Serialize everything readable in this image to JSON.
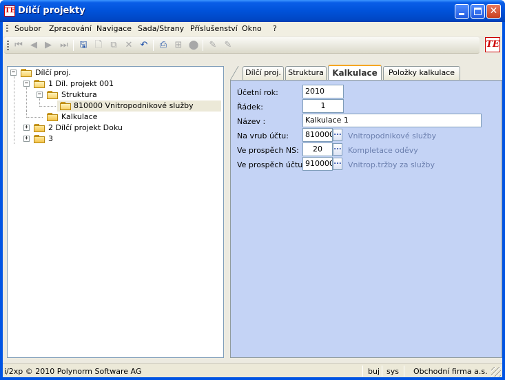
{
  "window": {
    "title": "Dílčí projekty",
    "app_icon": "TE"
  },
  "menu": [
    {
      "label": "Soubor"
    },
    {
      "label": "Zpracování"
    },
    {
      "label": "Navigace"
    },
    {
      "label": "Sada/Strany"
    },
    {
      "label": "Příslušenství"
    },
    {
      "label": "Okno"
    },
    {
      "label": "?"
    }
  ],
  "toolbar": {
    "logo": "TE"
  },
  "tree": {
    "root": "Dílčí proj.",
    "items": [
      {
        "label": "1 Díl. projekt 001"
      },
      {
        "label": "Struktura"
      },
      {
        "label": "810000 Vnitropodnikové služby"
      },
      {
        "label": "Kalkulace"
      },
      {
        "label": "2 Dílčí projekt Doku"
      },
      {
        "label": "3"
      }
    ]
  },
  "tabs": [
    {
      "label": "Dílčí proj."
    },
    {
      "label": "Struktura"
    },
    {
      "label": "Kalkulace"
    },
    {
      "label": "Položky kalkulace"
    }
  ],
  "form": {
    "ucetni_rok": {
      "label": "Účetní rok:",
      "value": "2010"
    },
    "radek": {
      "label": "Řádek:",
      "value": "1"
    },
    "nazev": {
      "label": "Název     :",
      "value": "Kalkulace 1"
    },
    "na_vrub": {
      "label": "Na vrub účtu:",
      "value": "810000",
      "desc": "Vnitropodnikové služby"
    },
    "ve_prospech_ns": {
      "label": "Ve prospěch NS:",
      "value": "20",
      "desc": "Kompletace oděvy"
    },
    "ve_prospech_uctu": {
      "label": "Ve prospěch účtu:",
      "value": "910000",
      "desc": "Vnitrop.tržby za služby"
    },
    "browse": "..."
  },
  "status": {
    "copyright": "i/2xp © 2010 Polynorm Software AG",
    "user": "buj",
    "system": "sys",
    "company": "Obchodní firma a.s."
  }
}
